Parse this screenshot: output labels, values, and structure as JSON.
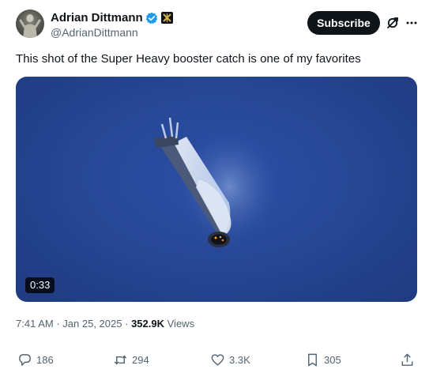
{
  "author": {
    "display_name": "Adrian Dittmann",
    "handle": "@AdrianDittmann"
  },
  "header": {
    "subscribe_label": "Subscribe"
  },
  "tweet": {
    "text": "This shot of the Super Heavy booster catch is one of my favorites",
    "video_duration": "0:33",
    "time": "7:41 AM",
    "separator": "·",
    "date": "Jan 25, 2025",
    "views_count": "352.9K",
    "views_label": "Views"
  },
  "actions": {
    "replies": "186",
    "reposts": "294",
    "likes": "3.3K",
    "bookmarks": "305"
  },
  "colors": {
    "primary_text": "#0f1419",
    "secondary_text": "#536471",
    "verified_blue": "#1d9bf0",
    "subscribe_bg": "#0f1419",
    "sky": "#274896"
  },
  "icons": [
    "avatar",
    "verified-badge-icon",
    "affiliate-badge-icon",
    "grok-icon",
    "more-icon",
    "reply-icon",
    "repost-icon",
    "like-icon",
    "bookmark-icon",
    "share-icon"
  ]
}
